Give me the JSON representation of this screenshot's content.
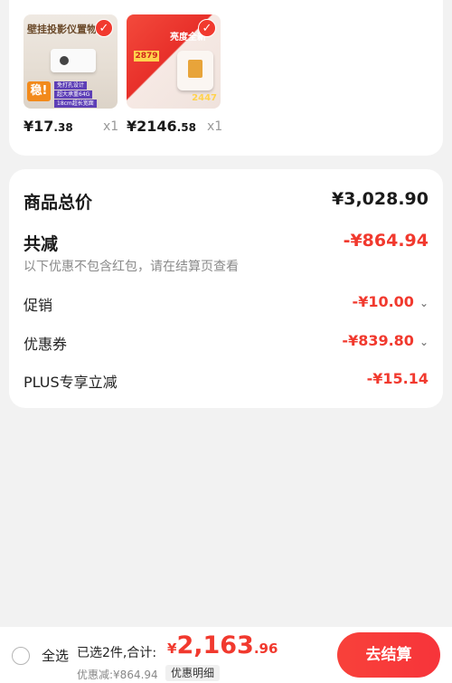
{
  "products": [
    {
      "image_title": "壁挂投影仪置物架",
      "image_badge": "稳!",
      "image_tags": [
        "免打孔设计",
        "超大承重64G",
        "18cm超长宽面"
      ],
      "price_int": "¥17",
      "price_dec": ".38",
      "qty": "x1"
    },
    {
      "image_title": "亮度全新",
      "image_price_top": "2879",
      "image_price_bottom": "2447",
      "price_int": "¥2146",
      "price_dec": ".58",
      "qty": "x1"
    }
  ],
  "summary": {
    "total_label": "商品总价",
    "total_value": "¥3,028.90",
    "discount_label": "共减",
    "discount_value": "-¥864.94",
    "note": "以下优惠不包含红包，请在结算页查看",
    "items": [
      {
        "label": "促销",
        "value": "-¥10.00",
        "has_dropdown": true
      },
      {
        "label": "优惠券",
        "value": "-¥839.80",
        "has_dropdown": true
      },
      {
        "label": "PLUS专享立减",
        "value": "-¥15.14",
        "has_dropdown": false
      }
    ]
  },
  "bottom_bar": {
    "select_all": "全选",
    "selected": "已选2件,合计:",
    "yen": "¥",
    "total_int": "2,163",
    "total_dec": ".96",
    "saved": "优惠减:¥864.94",
    "detail": "优惠明细",
    "checkout": "去结算"
  },
  "colors": {
    "accent": "#f1392e",
    "background": "#f2f2f2"
  }
}
